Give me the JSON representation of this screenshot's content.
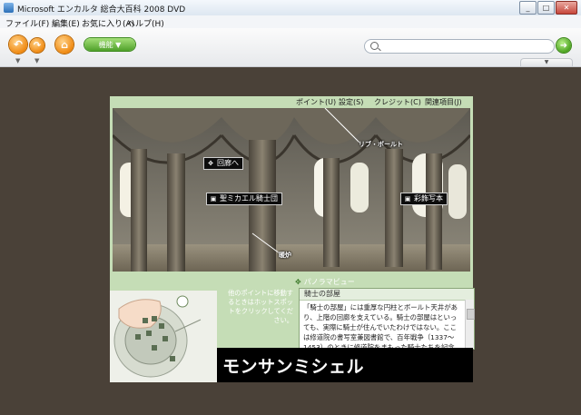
{
  "window": {
    "title": "Microsoft エンカルタ 総合大百科 2008 DVD"
  },
  "menu": [
    "ファイル(F)",
    "編集(E)",
    "お気に入り(A)",
    "ヘルプ(H)"
  ],
  "toolbar": {
    "function_label": "機能 ▼"
  },
  "search": {
    "placeholder": ""
  },
  "panel_menu": [
    "ポイント(U)",
    "設定(S)",
    "クレジット(C)",
    "関連項目(J)"
  ],
  "hotspots": [
    {
      "label": "回廊へ",
      "icon": "move"
    },
    {
      "label": "聖ミカエル騎士団",
      "icon": "info"
    },
    {
      "label": "彩飾写本",
      "icon": "info"
    }
  ],
  "photo_labels": [
    {
      "text": "リブ・ボールト"
    },
    {
      "text": "暖炉"
    }
  ],
  "panorama": {
    "label": "パノラマビュー"
  },
  "hint": "他のポイントに移動するときはホットスポットをクリックしてください。",
  "info": {
    "title": "騎士の部屋",
    "body": "「騎士の部屋」には重厚な円柱とボールト天井があり、上階の回廊を支えている。騎士の部屋はといっても、実際に騎士が住んでいたわけではない。ここは修道院の書写室兼図書館で、百年戦争（1337〜1453）のときに修道院をまもった騎士たちを記念してこう名づけられた。"
  },
  "title_text": "モンサンミシェル",
  "colors": {
    "panel_bg": "#c5ddb6",
    "window_bg": "#4a4138",
    "accent_orange": "#f08a12",
    "accent_green": "#4fa12a"
  }
}
